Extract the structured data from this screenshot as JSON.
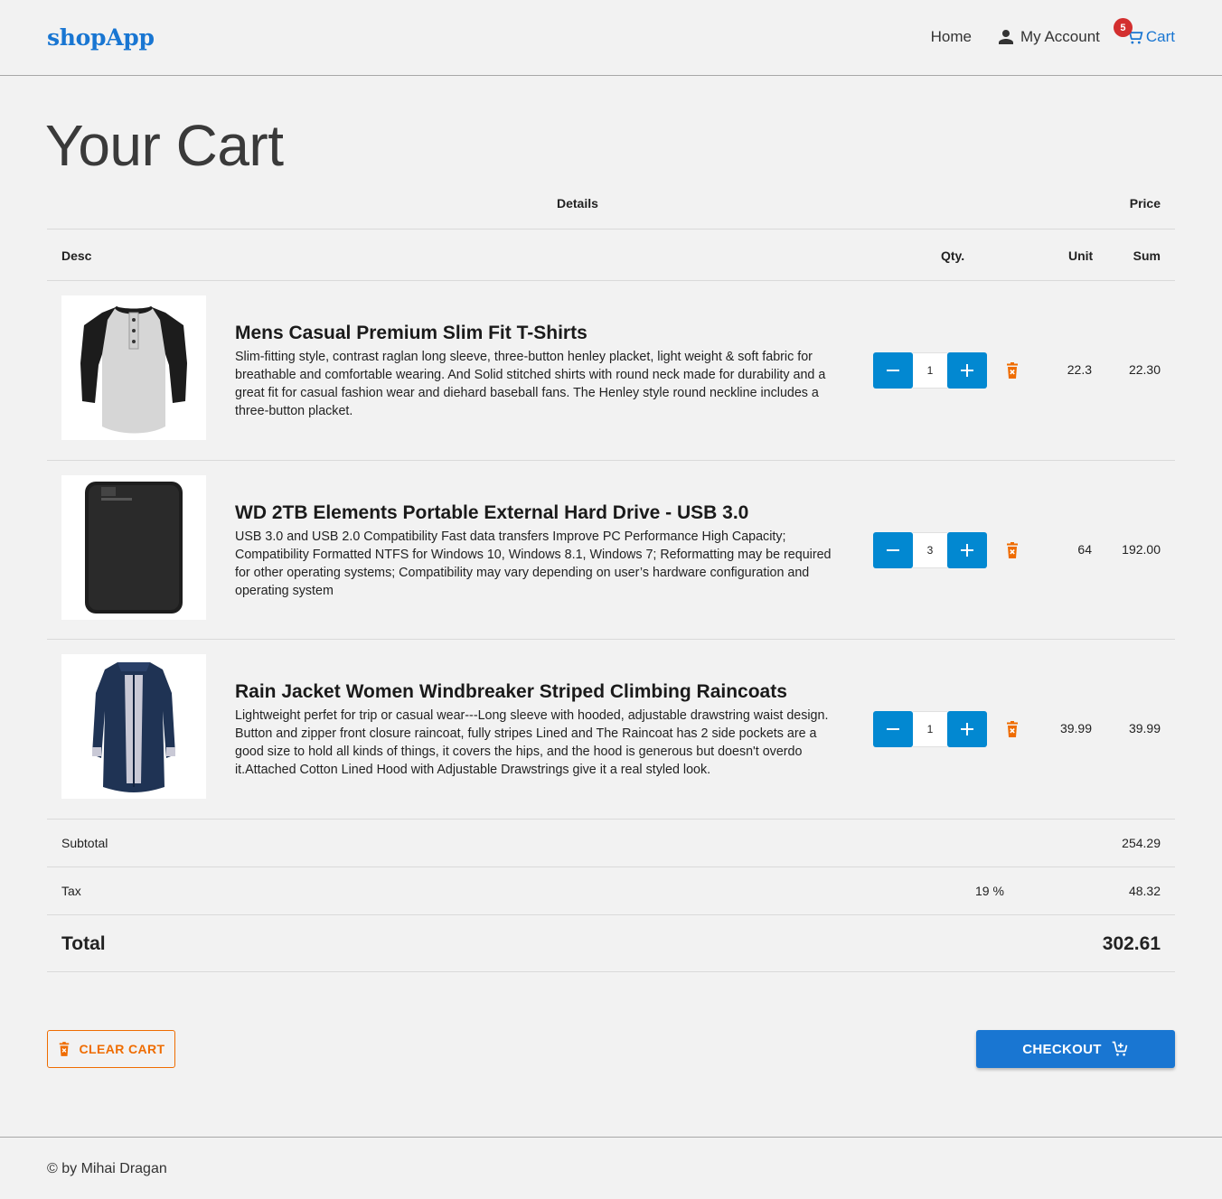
{
  "header": {
    "brand": "shopApp",
    "nav": {
      "home": "Home",
      "account": "My Account",
      "cart": "Cart",
      "cart_count": "5"
    },
    "icons": {
      "account": "person-icon",
      "cart": "cart-icon"
    }
  },
  "page": {
    "title": "Your Cart"
  },
  "table": {
    "group_headers": {
      "details": "Details",
      "price": "Price"
    },
    "columns": {
      "desc": "Desc",
      "qty": "Qty.",
      "unit": "Unit",
      "sum": "Sum"
    },
    "items": [
      {
        "name": "Mens Casual Premium Slim Fit T-Shirts",
        "description": "Slim-fitting style, contrast raglan long sleeve, three-button henley placket, light weight & soft fabric for breathable and comfortable wearing. And Solid stitched shirts with round neck made for durability and a great fit for casual fashion wear and diehard baseball fans. The Henley style round neckline includes a three-button placket.",
        "qty": "1",
        "unit": "22.3",
        "sum": "22.30",
        "image": "tshirt-image"
      },
      {
        "name": "WD 2TB Elements Portable External Hard Drive - USB 3.0",
        "description": "USB 3.0 and USB 2.0 Compatibility Fast data transfers Improve PC Performance High Capacity; Compatibility Formatted NTFS for Windows 10, Windows 8.1, Windows 7; Reformatting may be required for other operating systems; Compatibility may vary depending on user’s hardware configuration and operating system",
        "qty": "3",
        "unit": "64",
        "sum": "192.00",
        "image": "hard-drive-image"
      },
      {
        "name": "Rain Jacket Women Windbreaker Striped Climbing Raincoats",
        "description": "Lightweight perfet for trip or casual wear---Long sleeve with hooded, adjustable drawstring waist design. Button and zipper front closure raincoat, fully stripes Lined and The Raincoat has 2 side pockets are a good size to hold all kinds of things, it covers the hips, and the hood is generous but doesn't overdo it.Attached Cotton Lined Hood with Adjustable Drawstrings give it a real styled look.",
        "qty": "1",
        "unit": "39.99",
        "sum": "39.99",
        "image": "jacket-image"
      }
    ],
    "subtotal": {
      "label": "Subtotal",
      "value": "254.29"
    },
    "tax": {
      "label": "Tax",
      "rate": "19 %",
      "value": "48.32"
    },
    "total": {
      "label": "Total",
      "value": "302.61"
    }
  },
  "actions": {
    "clear": "CLEAR CART",
    "checkout": "CHECKOUT"
  },
  "footer": {
    "text": "© by Mihai Dragan"
  },
  "colors": {
    "brand": "#1976d2",
    "qty_button": "#0288d1",
    "danger": "#ef6c00",
    "badge": "#d32f2f"
  }
}
